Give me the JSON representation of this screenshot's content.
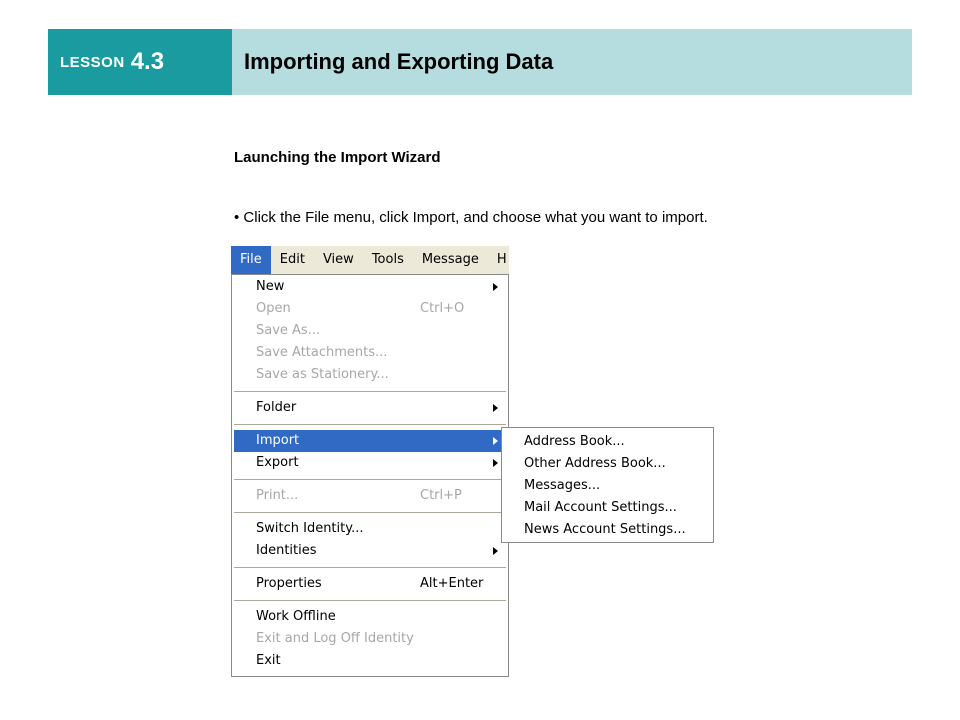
{
  "slide": {
    "lesson_word": "LESSON",
    "lesson_number": "4.3",
    "title": "Importing and Exporting Data",
    "subtitle": "Launching the Import Wizard",
    "bullet": "• Click the File menu, click Import, and choose what you want to import."
  },
  "menubar": {
    "items": [
      "File",
      "Edit",
      "View",
      "Tools",
      "Message",
      "H"
    ]
  },
  "file_menu": {
    "items": [
      {
        "label": "New",
        "shortcut": "",
        "disabled": false,
        "submenu": true
      },
      {
        "label": "Open",
        "shortcut": "Ctrl+O",
        "disabled": true,
        "submenu": false
      },
      {
        "label": "Save As...",
        "shortcut": "",
        "disabled": true,
        "submenu": false
      },
      {
        "label": "Save Attachments...",
        "shortcut": "",
        "disabled": true,
        "submenu": false
      },
      {
        "label": "Save as Stationery...",
        "shortcut": "",
        "disabled": true,
        "submenu": false
      },
      {
        "label": "Folder",
        "shortcut": "",
        "disabled": false,
        "submenu": true
      },
      {
        "label": "Import",
        "shortcut": "",
        "disabled": false,
        "submenu": true,
        "selected": true
      },
      {
        "label": "Export",
        "shortcut": "",
        "disabled": false,
        "submenu": true
      },
      {
        "label": "Print...",
        "shortcut": "Ctrl+P",
        "disabled": true,
        "submenu": false
      },
      {
        "label": "Switch Identity...",
        "shortcut": "",
        "disabled": false,
        "submenu": false
      },
      {
        "label": "Identities",
        "shortcut": "",
        "disabled": false,
        "submenu": true
      },
      {
        "label": "Properties",
        "shortcut": "Alt+Enter",
        "disabled": false,
        "submenu": false
      },
      {
        "label": "Work Offline",
        "shortcut": "",
        "disabled": false,
        "submenu": false
      },
      {
        "label": "Exit and Log Off Identity",
        "shortcut": "",
        "disabled": true,
        "submenu": false
      },
      {
        "label": "Exit",
        "shortcut": "",
        "disabled": false,
        "submenu": false
      }
    ]
  },
  "import_submenu": {
    "items": [
      "Address Book...",
      "Other Address Book...",
      "Messages...",
      "Mail Account Settings...",
      "News Account Settings..."
    ]
  },
  "colors": {
    "lesson_box": "#1a9ba0",
    "title_box": "#b5dde0",
    "menu_highlight": "#316ac5",
    "disabled_text": "#a7a6aa"
  }
}
